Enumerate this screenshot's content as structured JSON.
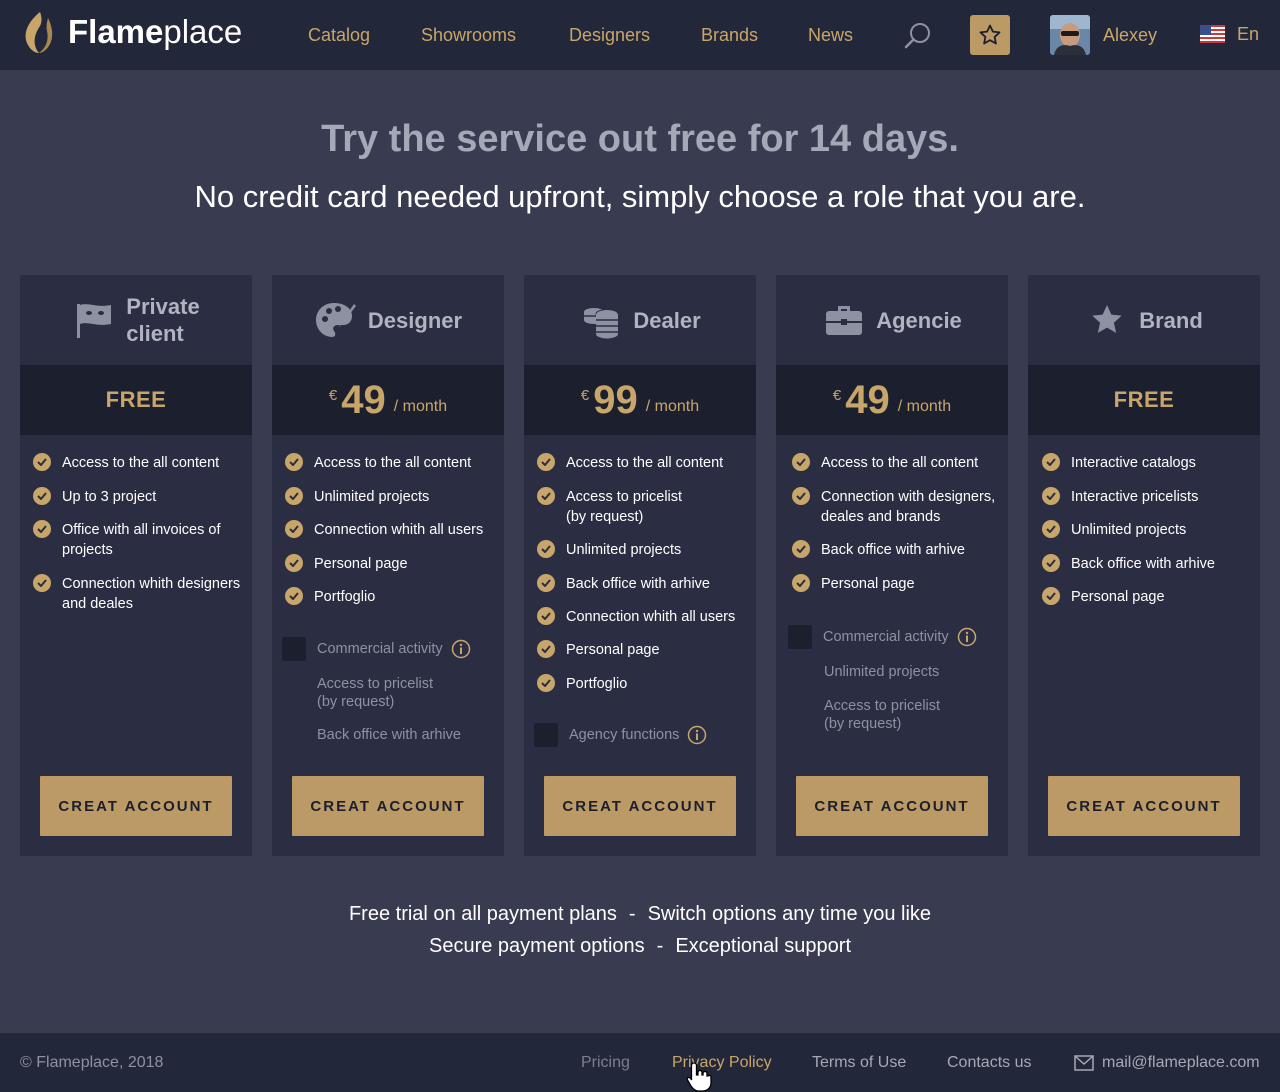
{
  "header": {
    "logo": {
      "bold": "Flame",
      "light": "place"
    },
    "nav": [
      "Catalog",
      "Showrooms",
      "Designers",
      "Brands",
      "News"
    ],
    "user_name": "Alexey",
    "language": "En"
  },
  "hero": {
    "title": "Try the service out free for 14 days.",
    "subtitle": "No credit card needed upfront, simply choose a role that you are."
  },
  "plans": [
    {
      "title_line1": "Private",
      "title_line2": "client",
      "icon": "mask-flag-icon",
      "price_free": "FREE",
      "features": [
        "Access to the all content",
        "Up to 3 project",
        "Office with all invoices of projects",
        "Connection whith designers and deales"
      ],
      "cta": "CREAT ACCOUNT"
    },
    {
      "title": "Designer",
      "icon": "palette-icon",
      "currency": "€",
      "price": "49",
      "period": "/ month",
      "features": [
        "Access to the all content",
        "Unlimited projects",
        "Connection whith all users",
        "Personal page",
        "Portfoglio"
      ],
      "option": "Commercial activity",
      "extras": [
        "Access to pricelist\n(by request)",
        "Back office with arhive"
      ],
      "cta": "CREAT ACCOUNT"
    },
    {
      "title": "Dealer",
      "icon": "coins-icon",
      "currency": "€",
      "price": "99",
      "period": "/ month",
      "features": [
        "Access to the all content",
        "Access to pricelist\n(by request)",
        "Unlimited projects",
        "Back office with arhive",
        "Connection whith all users",
        "Personal page",
        "Portfoglio"
      ],
      "option": "Agency functions",
      "cta": "CREAT ACCOUNT"
    },
    {
      "title": "Agencie",
      "icon": "briefcase-icon",
      "currency": "€",
      "price": "49",
      "period": "/ month",
      "features": [
        "Access to the all content",
        "Connection with designers,\ndeales and brands",
        "Back office with arhive",
        "Personal page"
      ],
      "option": "Commercial activity",
      "extras": [
        "Unlimited projects",
        "Access to pricelist\n(by request)"
      ],
      "cta": "CREAT ACCOUNT"
    },
    {
      "title": "Brand",
      "icon": "star-icon",
      "price_free": "FREE",
      "features": [
        "Interactive catalogs",
        "Interactive pricelists",
        "Unlimited projects",
        "Back office with arhive",
        "Personal page"
      ],
      "cta": "CREAT ACCOUNT"
    }
  ],
  "benefits": {
    "line1": [
      "Free trial on all payment plans",
      "Switch options any time you like"
    ],
    "line2": [
      "Secure payment options",
      "Exceptional support"
    ],
    "separator": "-"
  },
  "footer": {
    "copyright": "© Flameplace, 2018",
    "links": [
      "Pricing",
      "Privacy Policy",
      "Terms of Use",
      "Contacts us"
    ],
    "email": "mail@flameplace.com"
  },
  "colors": {
    "background": "#393c50",
    "header": "#23273a",
    "card": "#2b2e42",
    "price_band": "#1c1f2e",
    "accent": "#c8a66a",
    "button": "#bb9a65"
  }
}
